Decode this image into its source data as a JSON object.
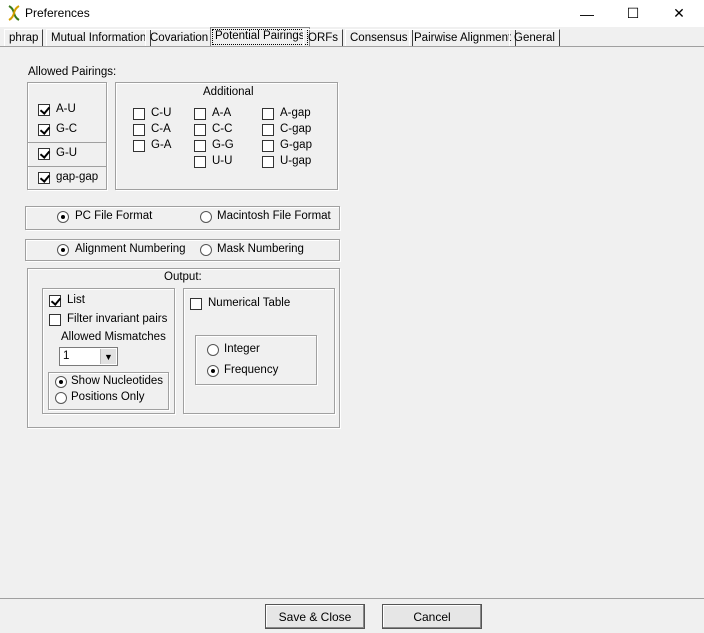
{
  "window": {
    "title": "Preferences",
    "minimize_glyph": "—",
    "maximize_glyph": "☐",
    "close_glyph": "✕",
    "icon": "dna-helix-icon"
  },
  "tabs": [
    {
      "label": "phrap"
    },
    {
      "label": "Mutual Information"
    },
    {
      "label": "Covariation"
    },
    {
      "label": "Potential Pairings",
      "active": true
    },
    {
      "label": "ORFs"
    },
    {
      "label": "Consensus"
    },
    {
      "label": "Pairwise Alignment"
    },
    {
      "label": "General"
    }
  ],
  "pairings": {
    "allowed_label": "Allowed Pairings:",
    "allowed": [
      {
        "label": "A-U",
        "checked": true
      },
      {
        "label": "G-C",
        "checked": true
      },
      {
        "label": "G-U",
        "checked": true
      },
      {
        "label": "gap-gap",
        "checked": true
      }
    ],
    "additional_label": "Additional",
    "additional": [
      {
        "label": "C-U",
        "checked": false
      },
      {
        "label": "C-A",
        "checked": false
      },
      {
        "label": "G-A",
        "checked": false
      },
      {
        "label": "A-A",
        "checked": false
      },
      {
        "label": "C-C",
        "checked": false
      },
      {
        "label": "G-G",
        "checked": false
      },
      {
        "label": "U-U",
        "checked": false
      },
      {
        "label": "A-gap",
        "checked": false
      },
      {
        "label": "C-gap",
        "checked": false
      },
      {
        "label": "G-gap",
        "checked": false
      },
      {
        "label": "U-gap",
        "checked": false
      }
    ]
  },
  "file_format": {
    "pc": "PC File Format",
    "mac": "Macintosh File Format",
    "selected": "pc"
  },
  "numbering": {
    "alignment": "Alignment Numbering",
    "mask": "Mask Numbering",
    "selected": "alignment"
  },
  "output": {
    "label": "Output:",
    "list": {
      "label": "List",
      "checked": true
    },
    "filter_invariant": {
      "label": "Filter invariant pairs",
      "checked": false
    },
    "allowed_mismatches_label": "Allowed Mismatches",
    "allowed_mismatches_value": "1",
    "show_nucleotides": "Show Nucleotides",
    "positions_only": "Positions Only",
    "display_selected": "show_nucleotides",
    "numerical_table": {
      "label": "Numerical Table",
      "checked": false
    },
    "integer": "Integer",
    "frequency": "Frequency",
    "number_selected": "frequency"
  },
  "footer": {
    "save_close": "Save & Close",
    "cancel": "Cancel"
  }
}
